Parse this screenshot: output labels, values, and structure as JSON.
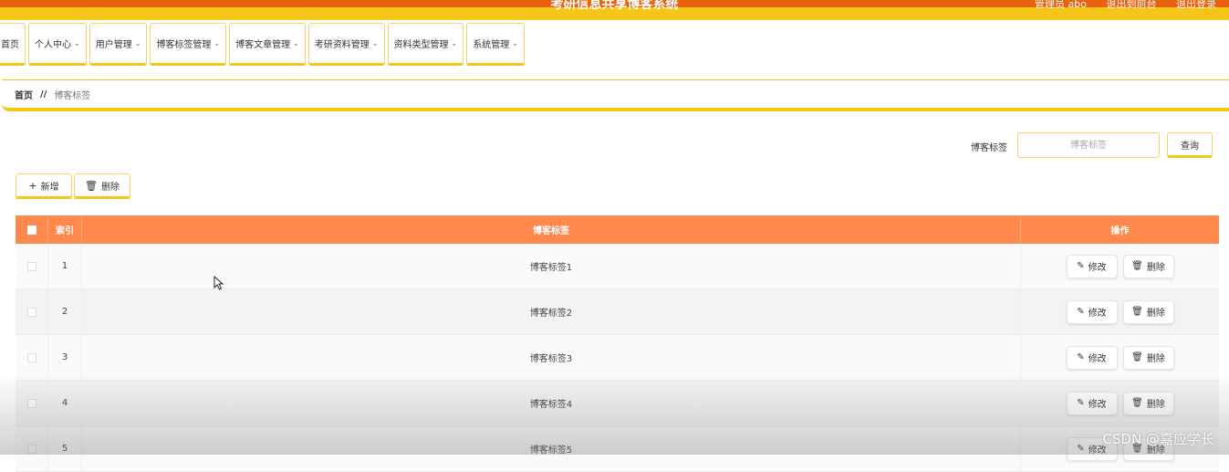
{
  "header": {
    "title": "考研信息共享博客系统",
    "user_text": "管理员 abo",
    "back_front": "退出到前台",
    "logout": "退出登录"
  },
  "nav": {
    "items": [
      {
        "label": "首页",
        "dropdown": false
      },
      {
        "label": "个人中心",
        "dropdown": true
      },
      {
        "label": "用户管理",
        "dropdown": true
      },
      {
        "label": "博客标签管理",
        "dropdown": true
      },
      {
        "label": "博客文章管理",
        "dropdown": true
      },
      {
        "label": "考研资料管理",
        "dropdown": true
      },
      {
        "label": "资料类型管理",
        "dropdown": true
      },
      {
        "label": "系统管理",
        "dropdown": true
      }
    ]
  },
  "breadcrumb": {
    "home": "首页",
    "separator": "//",
    "current": "博客标签"
  },
  "search": {
    "label": "博客标签",
    "placeholder": "博客标签",
    "button": "查询"
  },
  "toolbar": {
    "add_label": "新增",
    "delete_label": "删除"
  },
  "table": {
    "columns": [
      "索引",
      "博客标签",
      "操作"
    ],
    "rows": [
      {
        "index": "1",
        "tag": "博客标签1"
      },
      {
        "index": "2",
        "tag": "博客标签2"
      },
      {
        "index": "3",
        "tag": "博客标签3"
      },
      {
        "index": "4",
        "tag": "博客标签4"
      },
      {
        "index": "5",
        "tag": "博客标签5"
      }
    ],
    "edit_label": "修改",
    "delete_label": "删除"
  },
  "watermark": "CSDN @嘉应学长",
  "colors": {
    "accent_yellow": "#f5c518",
    "banner_orange": "#e8620f",
    "table_header": "#ff884d"
  }
}
